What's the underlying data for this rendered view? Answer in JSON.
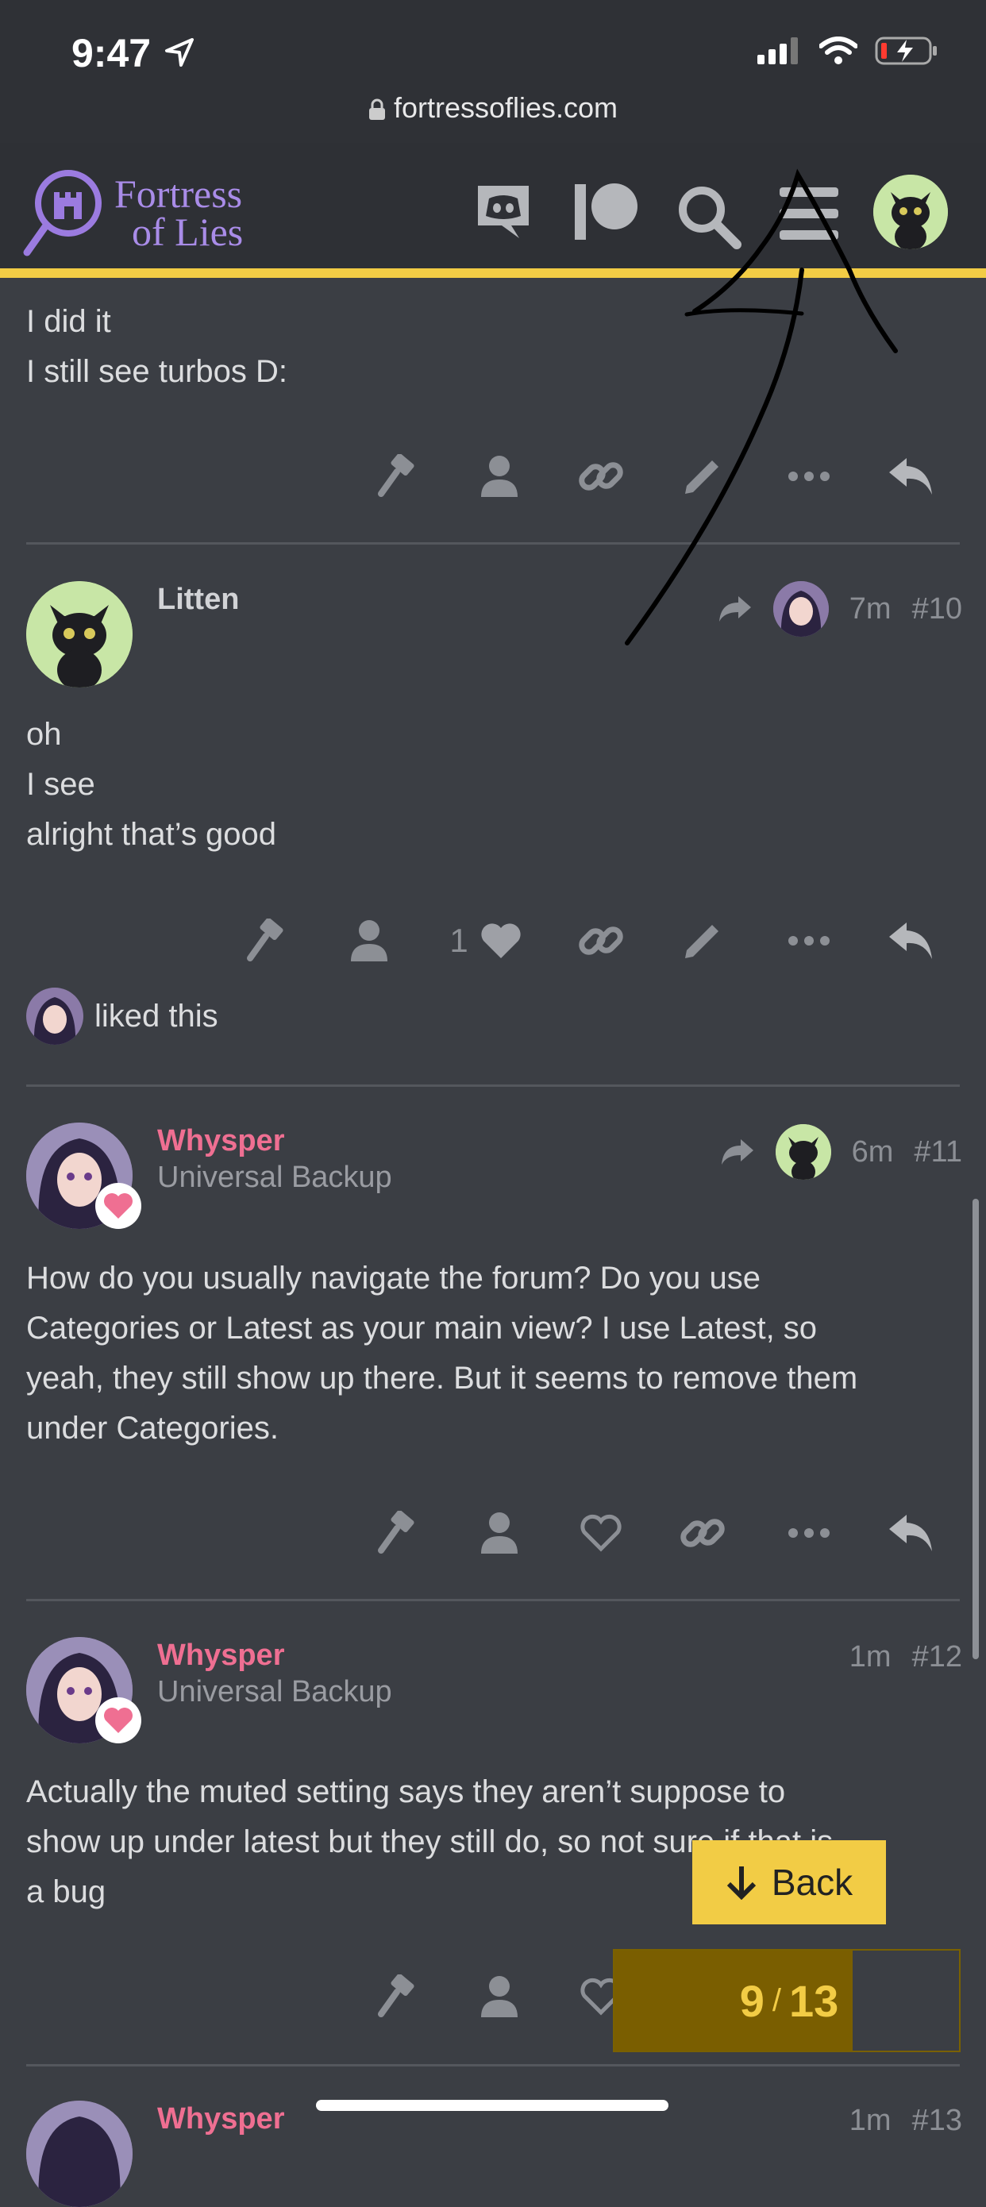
{
  "status_bar": {
    "time": "9:47"
  },
  "browser": {
    "url": "fortressoflies.com"
  },
  "site": {
    "logo_line1": "Fortress",
    "logo_line2": "of Lies"
  },
  "posts": [
    {
      "body": [
        "I did it",
        "I still see turbos D:"
      ]
    },
    {
      "username": "Litten",
      "time": "7m",
      "number": "#10",
      "body": [
        "oh",
        "I see",
        "alright that’s good"
      ],
      "like_count": "1",
      "liked_by_text": "liked this"
    },
    {
      "username": "Whysper",
      "user_title": "Universal Backup",
      "time": "6m",
      "number": "#11",
      "body": [
        "How do you usually navigate the forum? Do you use",
        "Categories or Latest as your main view? I use Latest, so",
        "yeah, they still show up there. But it seems to remove them",
        "under Categories."
      ]
    },
    {
      "username": "Whysper",
      "user_title": "Universal Backup",
      "time": "1m",
      "number": "#12",
      "body": [
        "Actually the muted setting says they aren’t suppose to",
        "show up under latest but they still do, so not sure if that is",
        "a bug"
      ]
    },
    {
      "username": "Whysper",
      "time": "1m",
      "number": "#13"
    }
  ],
  "back_button": {
    "label": "Back"
  },
  "progress": {
    "current": "9",
    "total": "13",
    "fraction": 0.6923
  },
  "colors": {
    "accent": "#f2cc45",
    "username_pink": "#ef6f92",
    "logo_purple": "#a98ce8"
  }
}
